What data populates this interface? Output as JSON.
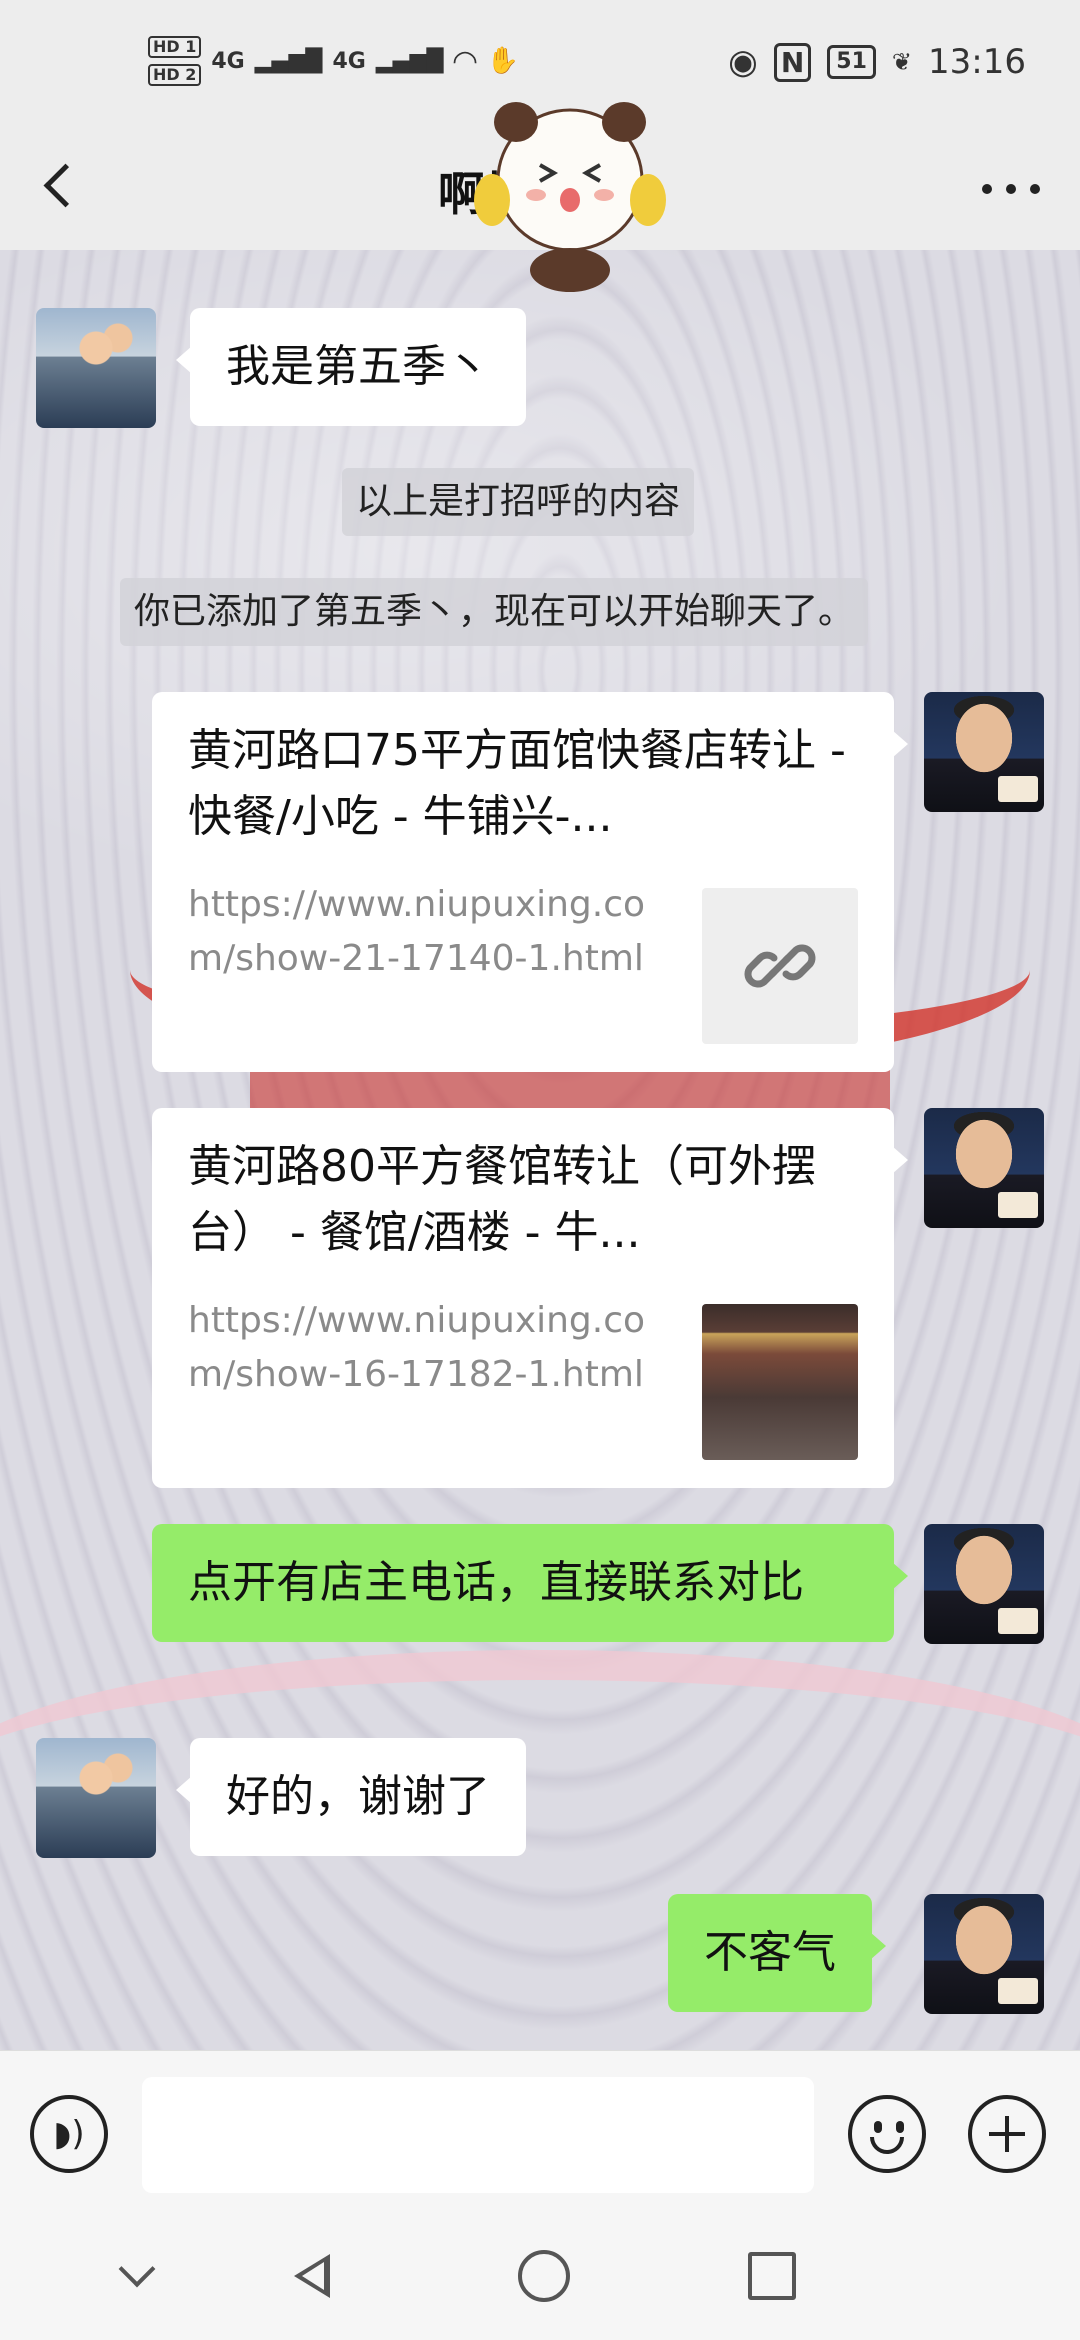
{
  "status_bar": {
    "hd1": "HD 1",
    "hd2": "HD 2",
    "sig1": "4G",
    "sig2": "4G",
    "battery": "51",
    "time": "13:16"
  },
  "header": {
    "title": "啊找1   61"
  },
  "messages": {
    "m1": "我是第五季丶",
    "sys1": "以上是打招呼的内容",
    "sys2": "你已添加了第五季丶，现在可以开始聊天了。",
    "link1": {
      "title": "黄河路口75平方面馆快餐店转让 - 快餐/小吃 - 牛铺兴-...",
      "url": "https://www.niupuxing.com/show-21-17140-1.html"
    },
    "link2": {
      "title": "黄河路80平方餐馆转让（可外摆台） - 餐馆/酒楼 - 牛...",
      "url": "https://www.niupuxing.com/show-16-17182-1.html"
    },
    "m2": "点开有店主电话，直接联系对比",
    "m3": "好的，谢谢了",
    "m4": "不客气"
  },
  "input": {
    "placeholder": ""
  },
  "icons": [
    "back-icon",
    "more-icon",
    "voice-icon",
    "emoji-icon",
    "plus-icon",
    "link-icon",
    "nav-down-icon",
    "nav-back-icon",
    "nav-home-icon",
    "nav-recent-icon"
  ]
}
